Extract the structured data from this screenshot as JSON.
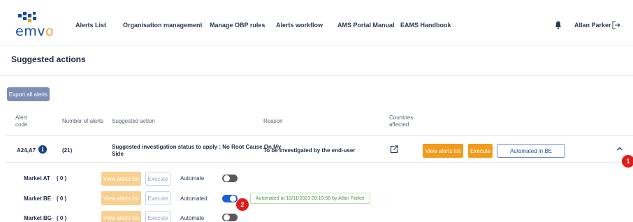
{
  "logo": {
    "text_main": "emv",
    "text_accent": "o"
  },
  "nav": [
    {
      "label": "Alerts List",
      "name": "nav-alerts-list"
    },
    {
      "label": "Organisation management",
      "name": "nav-organisation-management"
    },
    {
      "label": "Manage OBP rules",
      "name": "nav-manage-obp-rules"
    },
    {
      "label": "Alerts workflow",
      "name": "nav-alerts-workflow"
    },
    {
      "label": "AMS Portal Manual",
      "name": "nav-ams-portal-manual"
    },
    {
      "label": "EAMS Handbook",
      "name": "nav-eams-handbook"
    }
  ],
  "user": {
    "name": "Allan Parker",
    "icons": [
      "bell-icon",
      "logout-icon"
    ]
  },
  "page": {
    "title": "Suggested actions",
    "export_label": "Export all alerts"
  },
  "table": {
    "headers": {
      "alert_code_1": "Alert",
      "alert_code_2": "code",
      "number_of_alerts": "Number of alerts",
      "suggested_action": "Suggested action",
      "reason": "Reason",
      "countries_1": "Countries",
      "countries_2": "affected"
    },
    "row": {
      "alert_code": "A24,A7",
      "info_glyph": "i",
      "count": "(21)",
      "suggested_action_1": "Suggested investigation status to apply : No Root Cause On My",
      "suggested_action_2": "Side",
      "reason": "To be investigated by the end-user",
      "view_label": "View alerts list",
      "execute_label": "Execute",
      "automated_label": "Automated in BE"
    },
    "markets": [
      {
        "label": "Market  AT",
        "count": "( 0 )",
        "view_label": "View alerts list",
        "execute_label": "Execute",
        "automate_label": "Automate",
        "toggle_on": false
      },
      {
        "label": "Market  BE",
        "count": "( 0 )",
        "view_label": "View alerts list",
        "execute_label": "Execute",
        "automate_label": "Automated",
        "toggle_on": true,
        "note": "Automated at 10/11/2023 09:19:58 by Allan Parker"
      },
      {
        "label": "Market  BG",
        "count": "( 0 )",
        "view_label": "View alerts list",
        "execute_label": "Execute",
        "automate_label": "Automate",
        "toggle_on": false
      }
    ]
  },
  "badges": {
    "one": "1",
    "two": "2"
  },
  "colors": {
    "orange": "#f29a1b",
    "navy": "#1a3f86",
    "blue": "#1a5dd6",
    "red": "#e31b1b",
    "green": "#4a9a3c"
  }
}
